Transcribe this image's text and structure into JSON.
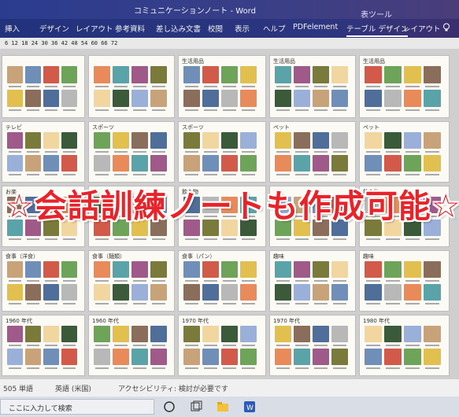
{
  "window": {
    "title": "コミュニケーションノート - Word",
    "contextual_tools": "表ツール"
  },
  "ribbon_tabs": [
    {
      "label": "挿入"
    },
    {
      "label": "デザイン"
    },
    {
      "label": "レイアウト"
    },
    {
      "label": "参考資料"
    },
    {
      "label": "差し込み文書"
    },
    {
      "label": "校閲"
    },
    {
      "label": "表示"
    },
    {
      "label": "ヘルプ"
    },
    {
      "label": "PDFelement"
    },
    {
      "label": "テーブル デザイン"
    },
    {
      "label": "レイアウト"
    }
  ],
  "ruler": {
    "marks": "6 12 18 24 30 36 42 48 54 60 66 72"
  },
  "cards": [
    {
      "label": ""
    },
    {
      "label": ""
    },
    {
      "label": "生活用品"
    },
    {
      "label": "生活用品"
    },
    {
      "label": "生活用品"
    },
    {
      "label": "テレビ"
    },
    {
      "label": "スポーツ"
    },
    {
      "label": "スポーツ"
    },
    {
      "label": "ペット"
    },
    {
      "label": "ペット"
    },
    {
      "label": "お楽"
    },
    {
      "label": ""
    },
    {
      "label": "飲み物"
    },
    {
      "label": ""
    },
    {
      "label": "飲み物"
    },
    {
      "label": "食事（洋食）"
    },
    {
      "label": "食事（麺類）"
    },
    {
      "label": "食事（パン）"
    },
    {
      "label": "趣味"
    },
    {
      "label": "趣味"
    },
    {
      "label": "1960 年代"
    },
    {
      "label": "1960 年代"
    },
    {
      "label": "1970 年代"
    },
    {
      "label": "1970 年代"
    },
    {
      "label": "1980 年代"
    }
  ],
  "overlay": {
    "banner": "☆会話訓練ノートも作成可能☆"
  },
  "statusbar": {
    "word_count": "505 単語",
    "language": "英語 (米国)",
    "accessibility": "アクセシビリティ: 検討が必要です"
  },
  "taskbar": {
    "search_placeholder": "ここに入力して検索"
  }
}
